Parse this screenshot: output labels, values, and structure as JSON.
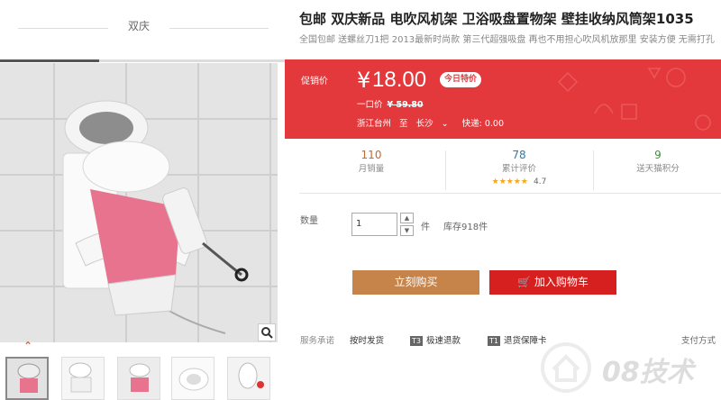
{
  "store": {
    "name": "双庆"
  },
  "product": {
    "title": "包邮 双庆新品 电吹风机架 卫浴吸盘置物架 壁挂收纳风筒架1035",
    "subtitle": "全国包邮 送螺丝刀1把 2013最新时尚款 第三代超强吸盘 再也不用担心吹风机放那里 安装方便 无需打孔"
  },
  "price": {
    "label": "促销价",
    "currency": "¥",
    "value": "18.00",
    "badge": "今日特价",
    "original_label": "一口价",
    "original_value": "¥ 59.80"
  },
  "shipping": {
    "from": "浙江台州",
    "to_word": "至",
    "to": "长沙",
    "fee": "快递: 0.00"
  },
  "stats": {
    "monthly_sales": {
      "value": "110",
      "label": "月销量"
    },
    "reviews": {
      "value": "78",
      "label": "累计评价",
      "stars": "★★★★★",
      "rating": "4.7"
    },
    "points": {
      "value": "9",
      "label": "送天猫积分"
    }
  },
  "quantity": {
    "label": "数量",
    "value": "1",
    "unit": "件",
    "stock": "库存918件"
  },
  "buttons": {
    "buy_now": "立刻购买",
    "add_cart": "加入购物车"
  },
  "service": {
    "label": "服务承诺",
    "items": [
      {
        "text": "按时发货",
        "tag": ""
      },
      {
        "text": "极速退款",
        "tag": "T3"
      },
      {
        "text": "退货保障卡",
        "tag": "T1"
      }
    ],
    "payment": "支付方式"
  },
  "watermark": "08技术",
  "colors": {
    "accent": "#e4393c",
    "buy_button": "#c7844a",
    "cart_button": "#d61f1f",
    "sales_number": "#c8682b",
    "reviews_number": "#2a7ab0",
    "points_number": "#3e8e3e"
  }
}
